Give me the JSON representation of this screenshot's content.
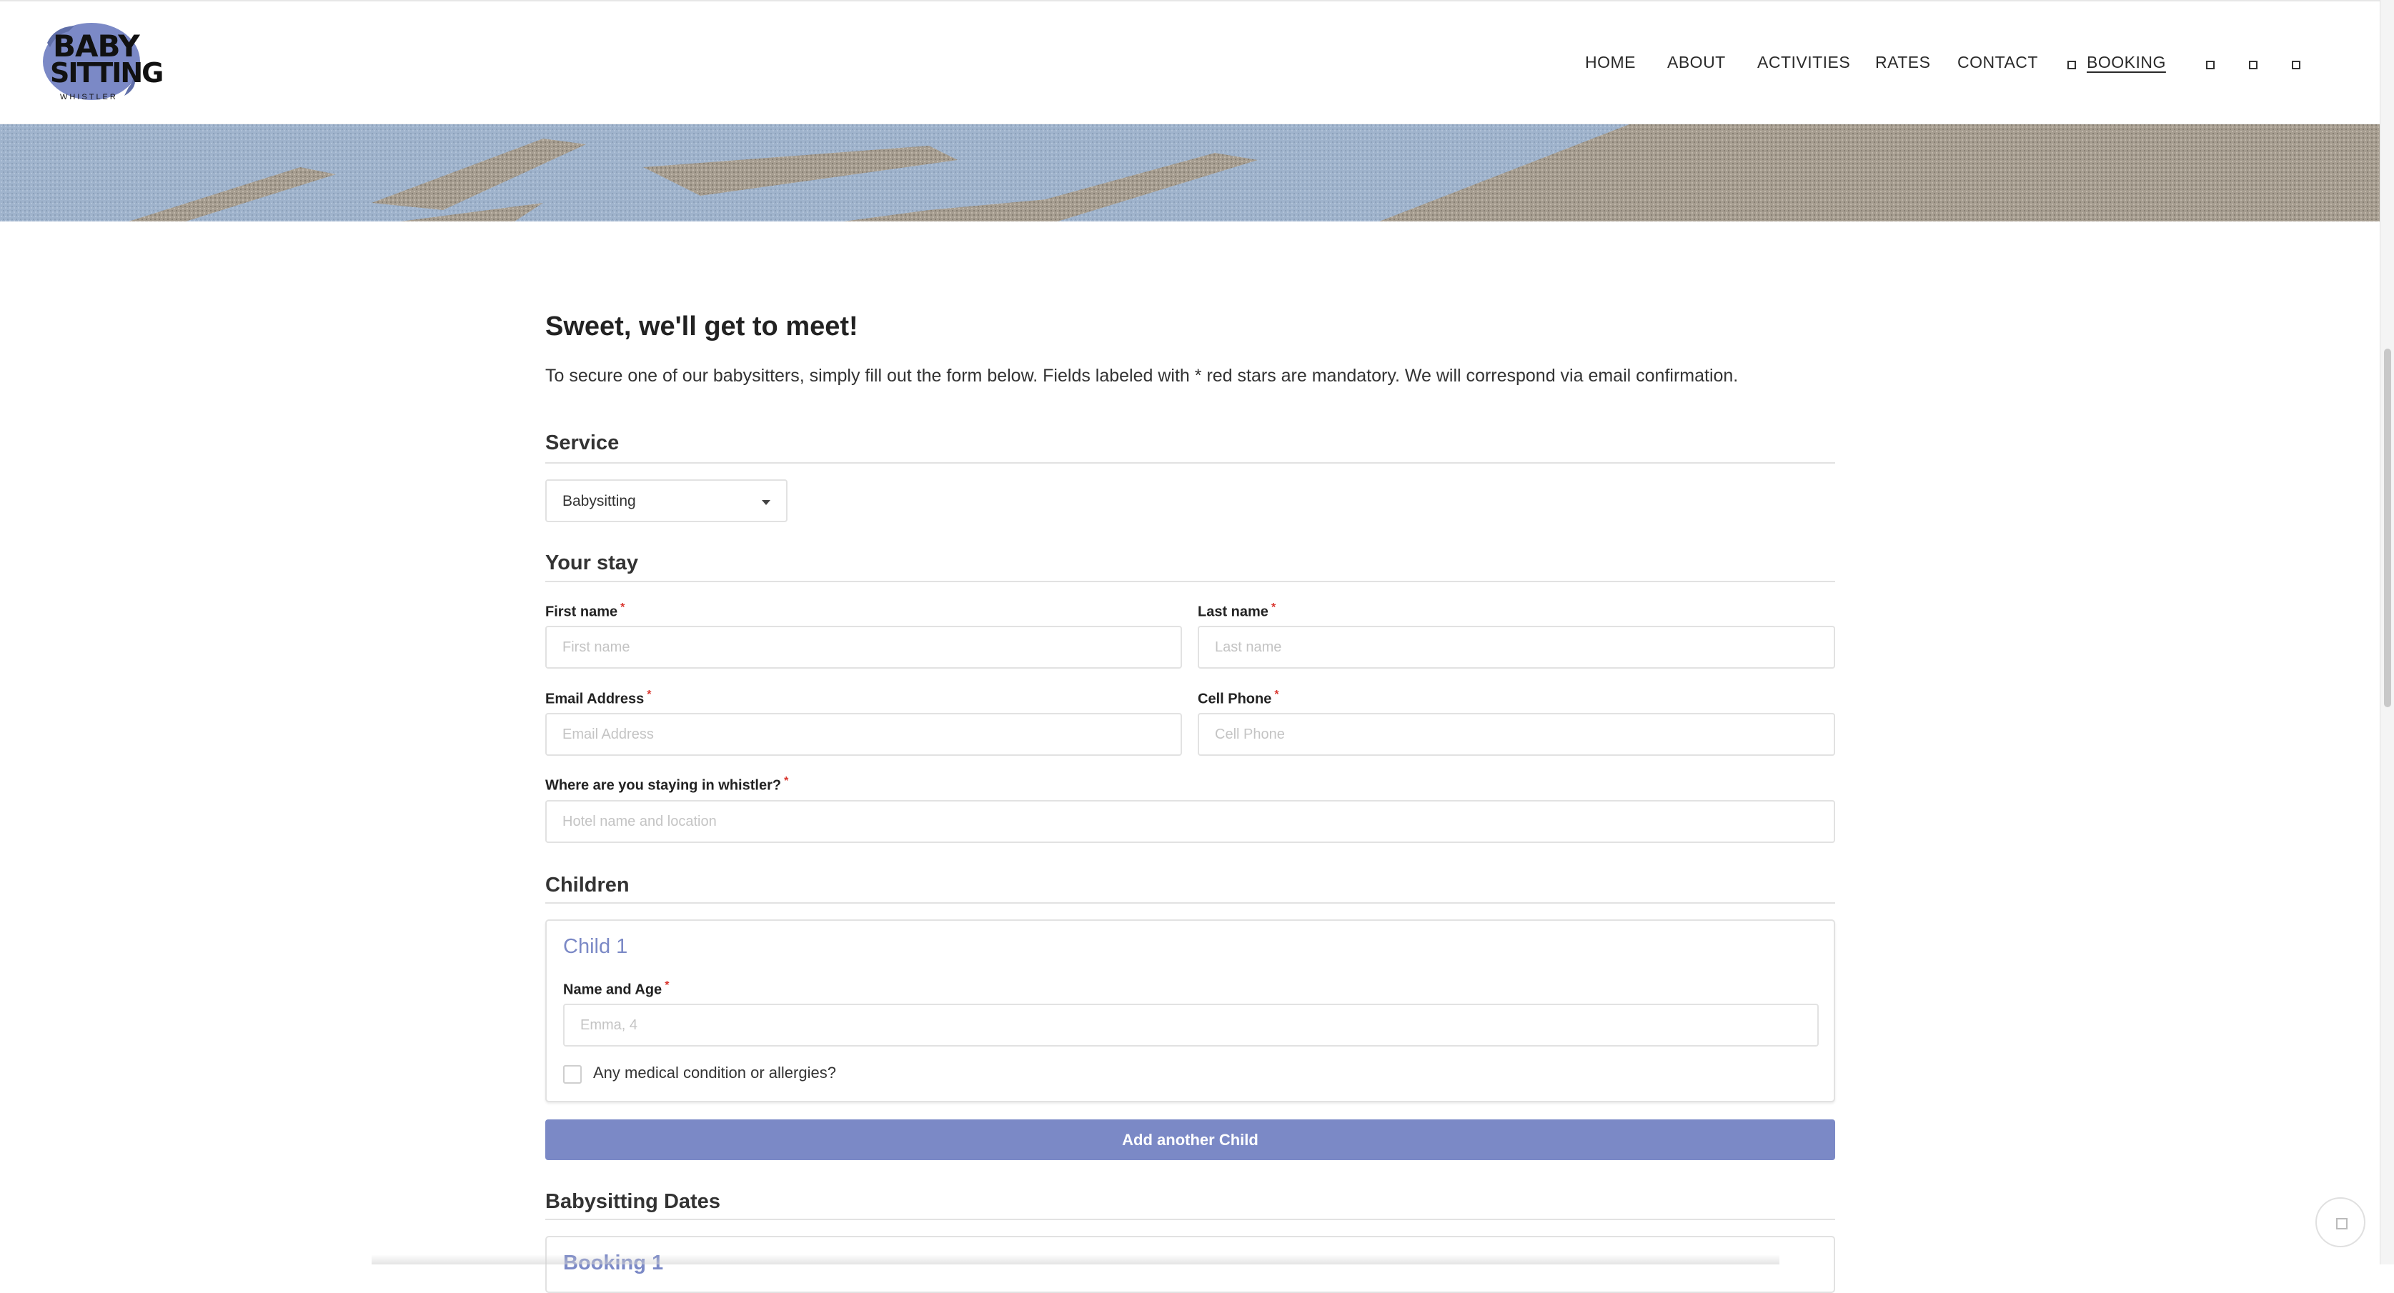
{
  "nav": {
    "items": [
      {
        "label": "HOME"
      },
      {
        "label": "ABOUT"
      },
      {
        "label": "ACTIVITIES"
      },
      {
        "label": "RATES"
      },
      {
        "label": "CONTACT"
      },
      {
        "label": "BOOKING",
        "active": true
      }
    ],
    "social_icons": [
      "square-icon",
      "square-icon",
      "square-icon"
    ]
  },
  "logo": {
    "line1": "BABY",
    "line2": "SITTING",
    "line3": "WHISTLER"
  },
  "heading": "Sweet, we'll get to meet!",
  "intro": "To secure one of our babysitters, simply fill out the form below. Fields labeled with * red stars are mandatory. We will correspond via email confirmation.",
  "service": {
    "title": "Service",
    "selected": "Babysitting"
  },
  "stay": {
    "title": "Your stay",
    "first_name_label": "First name",
    "first_name_placeholder": "First name",
    "last_name_label": "Last name",
    "last_name_placeholder": "Last name",
    "email_label": "Email Address",
    "email_placeholder": "Email Address",
    "phone_label": "Cell Phone",
    "phone_placeholder": "Cell Phone",
    "where_label": "Where are you staying in whistler?",
    "where_placeholder": "Hotel name and location"
  },
  "children": {
    "title": "Children",
    "child_title": "Child 1",
    "name_age_label": "Name and Age",
    "name_age_placeholder": "Emma, 4",
    "medical_label": "Any medical condition or allergies?",
    "add_button": "Add another Child"
  },
  "dates": {
    "title": "Babysitting Dates",
    "booking_title": "Booking 1"
  },
  "colors": {
    "accent": "#7b89c6",
    "required": "#d9362f"
  }
}
